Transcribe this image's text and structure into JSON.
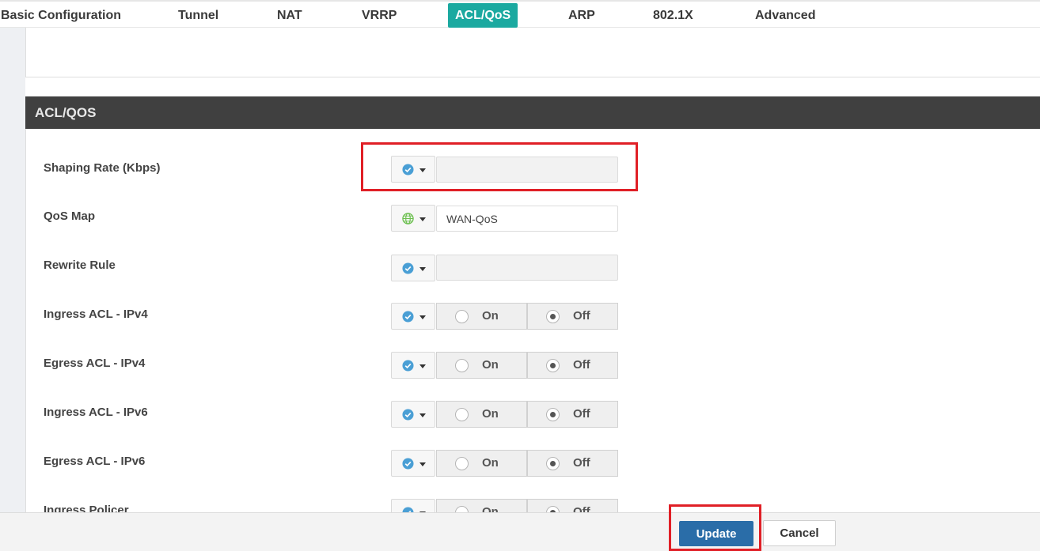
{
  "tabs": [
    {
      "label": "Basic Configuration",
      "active": false
    },
    {
      "label": "Tunnel",
      "active": false
    },
    {
      "label": "NAT",
      "active": false
    },
    {
      "label": "VRRP",
      "active": false
    },
    {
      "label": "ACL/QoS",
      "active": true
    },
    {
      "label": "ARP",
      "active": false
    },
    {
      "label": "802.1X",
      "active": false
    },
    {
      "label": "Advanced",
      "active": false
    }
  ],
  "section": {
    "title": "ACL/QOS"
  },
  "fields": {
    "shaping_rate": {
      "label": "Shaping Rate (Kbps)",
      "scope_icon": "check-circle-icon",
      "value": ""
    },
    "qos_map": {
      "label": "QoS Map",
      "scope_icon": "globe-icon",
      "value": "WAN-QoS"
    },
    "rewrite_rule": {
      "label": "Rewrite Rule",
      "scope_icon": "check-circle-icon",
      "value": ""
    },
    "ingress_acl_ipv4": {
      "label": "Ingress ACL - IPv4",
      "scope_icon": "check-circle-icon",
      "on_label": "On",
      "off_label": "Off",
      "selected": "Off"
    },
    "egress_acl_ipv4": {
      "label": "Egress ACL - IPv4",
      "scope_icon": "check-circle-icon",
      "on_label": "On",
      "off_label": "Off",
      "selected": "Off"
    },
    "ingress_acl_ipv6": {
      "label": "Ingress ACL - IPv6",
      "scope_icon": "check-circle-icon",
      "on_label": "On",
      "off_label": "Off",
      "selected": "Off"
    },
    "egress_acl_ipv6": {
      "label": "Egress ACL - IPv6",
      "scope_icon": "check-circle-icon",
      "on_label": "On",
      "off_label": "Off",
      "selected": "Off"
    },
    "ingress_policer": {
      "label": "Ingress Policer",
      "scope_icon": "check-circle-icon",
      "on_label": "On",
      "off_label": "Off",
      "selected": "Off"
    }
  },
  "footer": {
    "update_label": "Update",
    "cancel_label": "Cancel"
  },
  "colors": {
    "active_tab": "#1ba9a0",
    "section_header": "#404040",
    "update_button": "#2a6da8",
    "annotation": "#e01f26",
    "check_icon": "#4a9fd5",
    "globe_icon": "#6bbf4e"
  }
}
